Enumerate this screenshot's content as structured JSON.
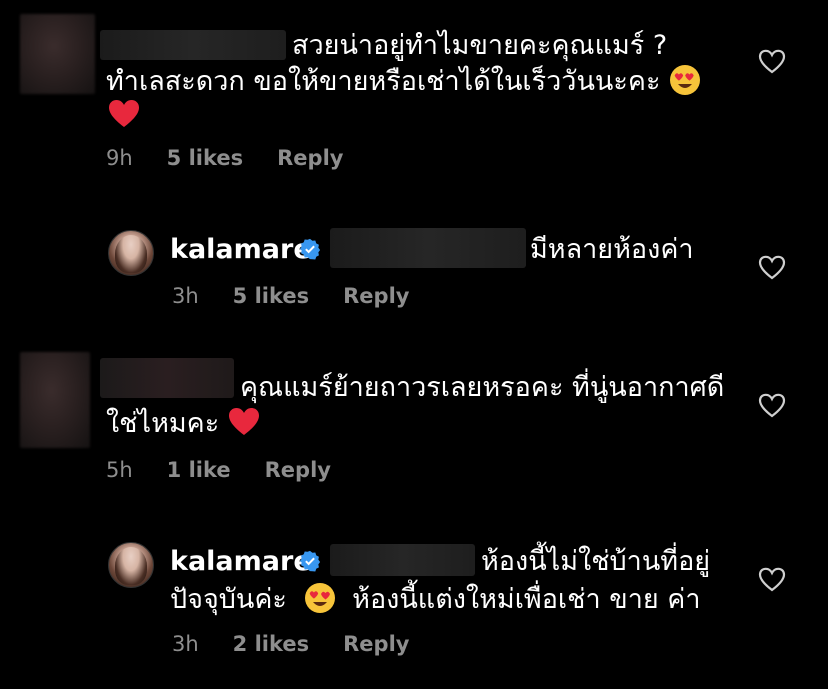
{
  "comments": [
    {
      "line1": "สวยน่าอยู่ทำไมขายคะคุณแมร์ ?",
      "line2": "ทำเลสะดวก ขอให้ขายหรือเช่าได้ในเร็ววันนะคะ",
      "time": "9h",
      "likes": "5 likes",
      "reply": "Reply"
    },
    {
      "username": "kalamare",
      "line1": "มีหลายห้องค่า",
      "time": "3h",
      "likes": "5 likes",
      "reply": "Reply"
    },
    {
      "line1": "คุณแมร์ย้ายถาวรเลยหรอคะ ที่นู่นอากาศดี",
      "line2": "ใช่ไหมคะ",
      "time": "5h",
      "likes": "1 like",
      "reply": "Reply"
    },
    {
      "username": "kalamare",
      "line1": "ห้องนี้ไม่ใช่บ้านที่อยู่",
      "line2a": "ปัจจุบันค่ะ",
      "line2b": "ห้องนี้แต่งใหม่เพื่อเช่า ขาย ค่า",
      "time": "3h",
      "likes": "2 likes",
      "reply": "Reply"
    }
  ],
  "icons": {
    "like": "heart-outline-icon",
    "verified": "verified-badge-icon",
    "emoji_heart": "red-heart-emoji",
    "emoji_face": "heart-eyes-emoji"
  },
  "colors": {
    "background": "#000000",
    "text": "#ffffff",
    "meta": "#8e8e8e",
    "verified": "#3897f0",
    "heart": "#e0245e"
  }
}
